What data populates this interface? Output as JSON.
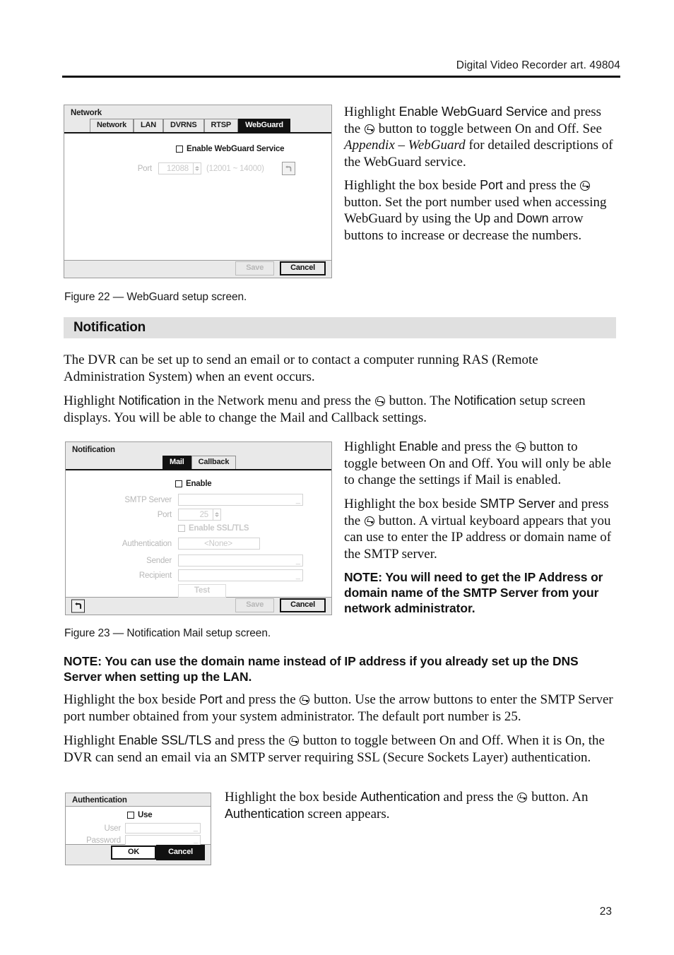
{
  "header": {
    "running_head": "Digital Video Recorder art. 49804"
  },
  "page_number": "23",
  "figure22": {
    "caption": "Figure 22 — WebGuard setup screen.",
    "dialog_title": "Network",
    "tabs": [
      {
        "label": "Network",
        "active": false
      },
      {
        "label": "LAN",
        "active": false
      },
      {
        "label": "DVRNS",
        "active": false
      },
      {
        "label": "RTSP",
        "active": false
      },
      {
        "label": "WebGuard",
        "active": true
      }
    ],
    "enable_checkbox_label": "Enable WebGuard Service",
    "port_label": "Port",
    "port_value": "12088",
    "port_range": "(12001 ~ 14000)",
    "back_icon": "back-arrow-icon",
    "save_label": "Save",
    "cancel_label": "Cancel"
  },
  "figure23": {
    "caption": "Figure 23 — Notification Mail setup screen.",
    "dialog_title": "Notification",
    "tabs": [
      {
        "label": "Mail",
        "active": true
      },
      {
        "label": "Callback",
        "active": false
      }
    ],
    "enable_checkbox_label": "Enable",
    "smtp_label": "SMTP Server",
    "smtp_value": "",
    "port_label": "Port",
    "port_value": "25",
    "ssl_checkbox_label": "Enable SSL/TLS",
    "auth_label": "Authentication",
    "auth_value": "<None>",
    "sender_label": "Sender",
    "sender_value": "",
    "recipient_label": "Recipient",
    "recipient_value": "",
    "test_label": "Test",
    "back_icon": "back-arrow-icon",
    "save_label": "Save",
    "cancel_label": "Cancel"
  },
  "auth_dialog": {
    "dialog_title": "Authentication",
    "use_checkbox_label": "Use",
    "user_label": "User",
    "user_value": "",
    "password_label": "Password",
    "password_value": "",
    "ok_label": "OK",
    "cancel_label": "Cancel"
  },
  "section": {
    "notification_heading": "Notification"
  },
  "body_text": {
    "p1_a": "Highlight ",
    "p1_ui1": "Enable WebGuard Service",
    "p1_b": " and press the ",
    "p1_c": " button to toggle between On and Off.  See ",
    "p1_it": "Appendix – WebGuard",
    "p1_d": " for detailed descriptions of the WebGuard service.",
    "p2_a": "Highlight the box beside ",
    "p2_ui1": "Port",
    "p2_b": " and press the ",
    "p2_c": " button.  Set the port number used when accessing WebGuard by using the ",
    "p2_ui2": "Up",
    "p2_d": " and ",
    "p2_ui3": "Down",
    "p2_e": " arrow buttons to increase or decrease the numbers.",
    "p3": "The DVR can be set up to send an email or to contact a computer running RAS (Remote Administration System) when an event occurs.",
    "p4_a": "Highlight ",
    "p4_ui1": "Notification",
    "p4_b": " in the Network menu and press the ",
    "p4_c": " button.  The ",
    "p4_ui2": "Notification",
    "p4_d": " setup screen displays.  You will be able to change the Mail and Callback settings.",
    "p5_a": "Highlight ",
    "p5_ui1": "Enable",
    "p5_b": " and press the ",
    "p5_c": " button to toggle between On and Off.  You will only be able to change the settings if Mail is enabled.",
    "p6_a": "Highlight the box beside ",
    "p6_ui1": "SMTP Server",
    "p6_b": " and press the ",
    "p6_c": " button.  A virtual keyboard appears that you can use to enter the IP address or domain name of the SMTP server.",
    "note1": "NOTE:  You will need to get the IP Address or domain name of the SMTP Server from your network administrator.",
    "note2": "NOTE:  You can use the domain name instead of IP address if you already set up the DNS Server when setting up the LAN.",
    "p7_a": "Highlight the box beside ",
    "p7_ui1": "Port",
    "p7_b": " and press the ",
    "p7_c": " button.  Use the arrow buttons to enter the SMTP Server port number obtained from your system administrator.  The default port number is 25.",
    "p8_a": "Highlight ",
    "p8_ui1": "Enable SSL/TLS",
    "p8_b": " and press the ",
    "p8_c": " button to toggle between On and Off.  When it is On, the DVR can send an email via an SMTP server requiring SSL (Secure Sockets Layer) authentication.",
    "p9_a": "Highlight the box beside ",
    "p9_ui1": "Authentication",
    "p9_b": " and press the ",
    "p9_c": " button.  An ",
    "p9_ui2": "Authentication",
    "p9_d": " screen appears."
  }
}
